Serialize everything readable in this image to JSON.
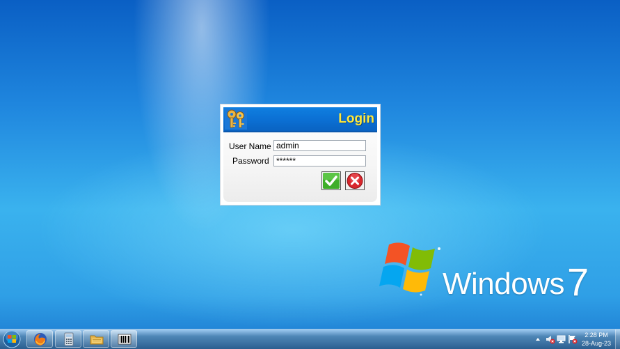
{
  "desktop": {
    "brand_text": "Windows",
    "brand_version": "7"
  },
  "login_dialog": {
    "title": "Login",
    "username_label": "User Name",
    "username_value": "admin",
    "password_label": "Password",
    "password_value": "******",
    "ok_icon": "check-icon",
    "cancel_icon": "close-icon",
    "colors": {
      "title_bar": "#0b6fd3",
      "title_text": "#ffe83a",
      "ok_green": "#3fae2a",
      "cancel_red": "#d8262c"
    }
  },
  "taskbar": {
    "pinned": [
      {
        "name": "firefox",
        "icon": "firefox-icon"
      },
      {
        "name": "calculator",
        "icon": "calculator-icon"
      },
      {
        "name": "explorer",
        "icon": "folder-icon"
      },
      {
        "name": "barcode-app",
        "icon": "barcode-icon"
      }
    ],
    "tray_icons": [
      "show-hidden-icons-icon",
      "volume-muted-icon",
      "network-icon",
      "action-center-icon"
    ],
    "clock": {
      "time": "2:28 PM",
      "date": "28-Aug-23"
    }
  }
}
